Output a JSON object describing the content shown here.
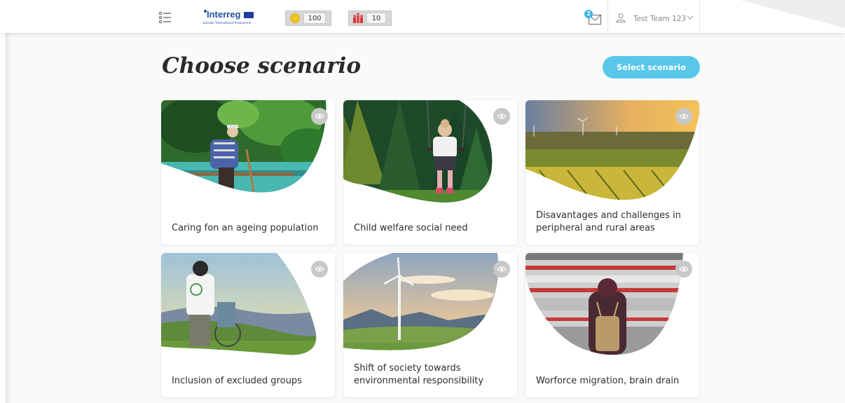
{
  "header": {
    "logo": {
      "brand": "Interreg",
      "subtitle": "Danube Transnational Programme"
    },
    "coins": {
      "icon": "coin-icon",
      "value": "100"
    },
    "people": {
      "icon": "team-icon",
      "value": "10"
    },
    "mail": {
      "icon": "mail-icon",
      "badge": "2"
    },
    "user": {
      "icon": "user-icon",
      "name": "Test Team 123"
    }
  },
  "main": {
    "title": "Choose scenario",
    "select_button": "Select scenario",
    "scenarios": [
      {
        "label": "Caring fon an ageing population"
      },
      {
        "label": "Child welfare social need"
      },
      {
        "label": "Disavantages and challenges in peripheral and rural areas"
      },
      {
        "label": "Inclusion of excluded groups"
      },
      {
        "label": "Shift of society towards environmental responsibility"
      },
      {
        "label": "Worforce migration, brain drain"
      }
    ]
  },
  "colors": {
    "accent": "#58c7ea",
    "badge": "#3bb4e6",
    "background": "#fafafa"
  }
}
